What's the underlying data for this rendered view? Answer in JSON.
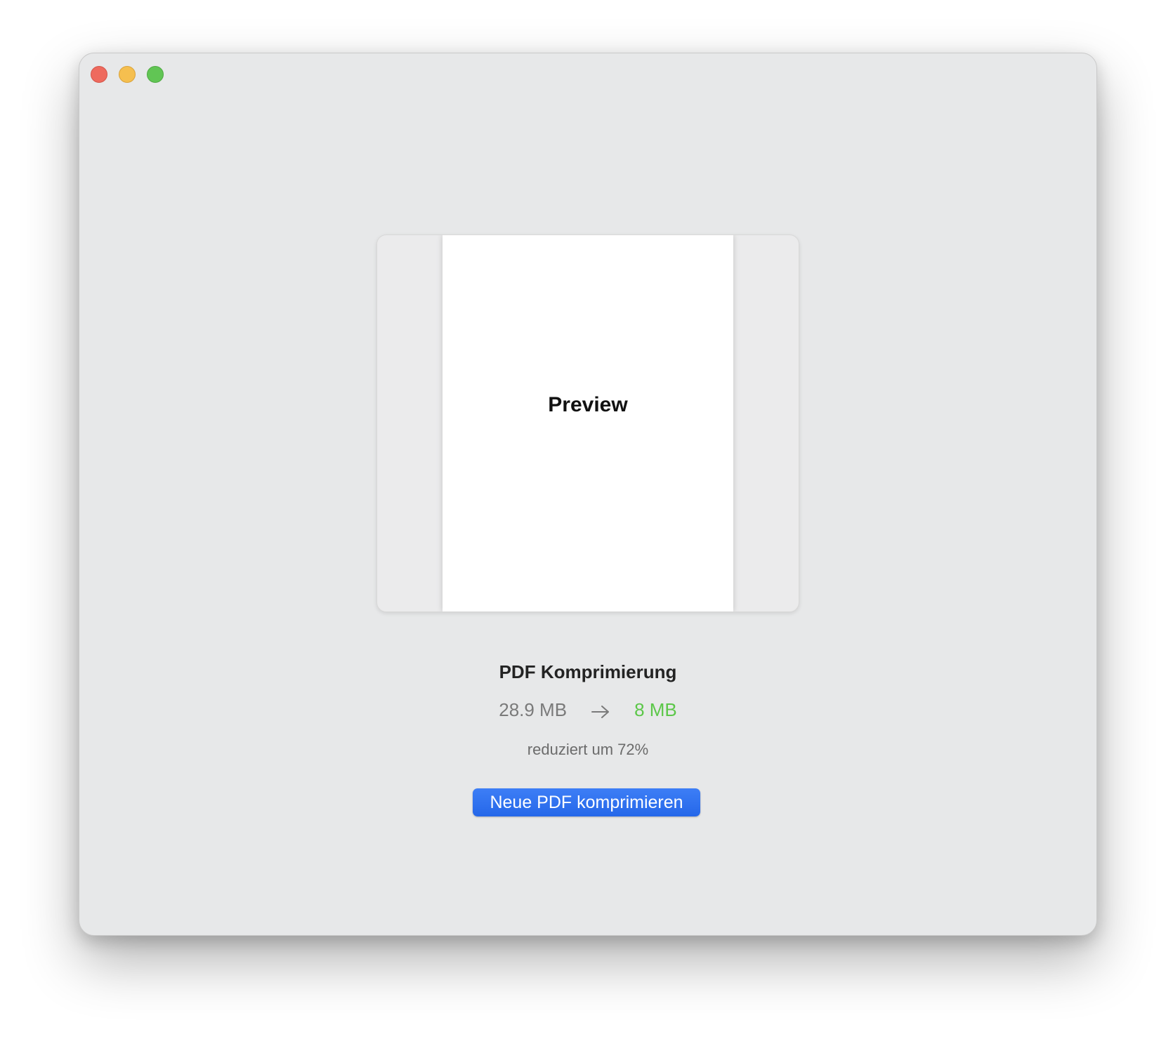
{
  "window": {
    "controls": [
      "close",
      "minimize",
      "zoom"
    ]
  },
  "preview": {
    "label": "Preview"
  },
  "result": {
    "title": "PDF Komprimierung",
    "original_size": "28.9 MB",
    "compressed_size": "8 MB",
    "reduction_text": "reduziert um 72%"
  },
  "actions": {
    "new_compression_label": "Neue PDF komprimieren"
  },
  "colors": {
    "accent": "#2f72f0",
    "success": "#5cc749",
    "window_bg": "#e7e8e9"
  },
  "icons": {
    "arrow": "arrow-right-icon"
  }
}
